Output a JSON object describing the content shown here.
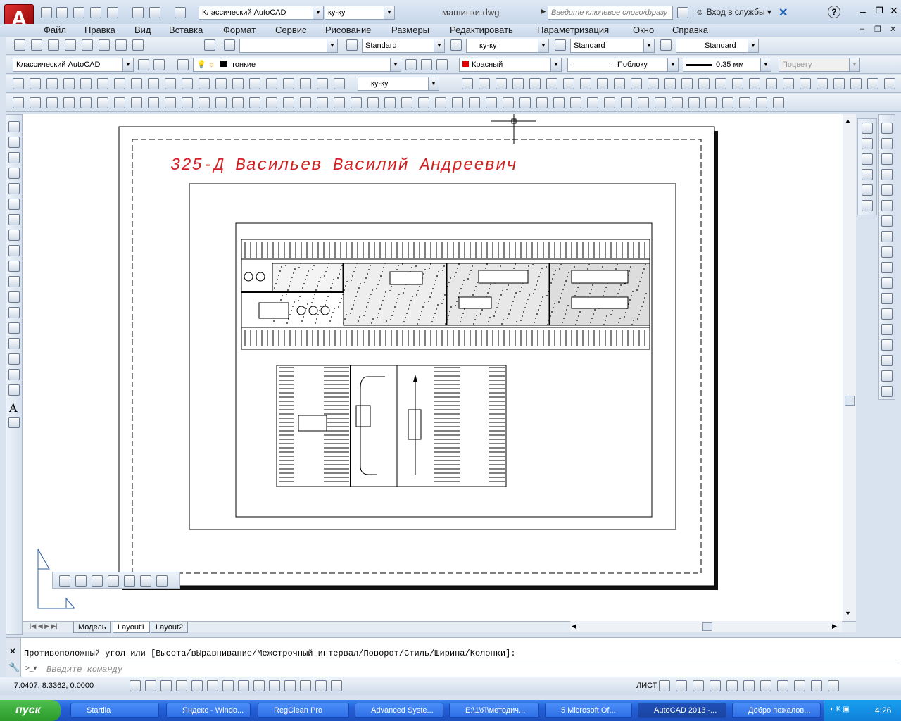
{
  "title": {
    "workspace": "Классический AutoCAD",
    "layer_combo": "ку-ку",
    "filename": "машинки.dwg",
    "search_placeholder": "Введите ключевое слово/фразу",
    "login": "Вход в службы"
  },
  "menu": [
    "Файл",
    "Правка",
    "Вид",
    "Вставка",
    "Формат",
    "Сервис",
    "Рисование",
    "Размеры",
    "Редактировать",
    "Параметризация",
    "Окно",
    "Справка"
  ],
  "styles_toolbar": {
    "text_style": "Standard",
    "dim_style": "ку-ку",
    "table_style": "Standard",
    "mleader_style": "Standard"
  },
  "layers_toolbar": {
    "workspace": "Классический AutoCAD",
    "layer": "тонкие",
    "color": "Красный",
    "linetype": "Поблоку",
    "lineweight": "0.35 мм",
    "plotstyle": "Поцвету"
  },
  "dim_toolbar": {
    "dim_style": "ку-ку"
  },
  "drawing": {
    "title_text": "325-Д Васильев Василий Андреевич"
  },
  "tabs": [
    "Модель",
    "Layout1",
    "Layout2"
  ],
  "active_tab": "Layout1",
  "command": {
    "history": "Противоположный угол или [Высота/вЫравнивание/Межстрочный интервал/Поворот/Стиль/Ширина/Колонки]:",
    "placeholder": "Введите команду"
  },
  "status": {
    "coords": "7.0407, 8.3362, 0.0000",
    "paper_label": "ЛИСТ"
  },
  "taskbar": {
    "start": "пуск",
    "items": [
      "Startila",
      "Яндекс - Windo...",
      "RegClean Pro",
      "Advanced Syste...",
      "E:\\1\\Я\\методич...",
      "5 Microsoft Of...",
      "AutoCAD 2013 -...",
      "Добро пожалов..."
    ],
    "time": "4:26"
  },
  "colors": {
    "accent_red": "#c00000",
    "drawing_text": "#d02020"
  }
}
